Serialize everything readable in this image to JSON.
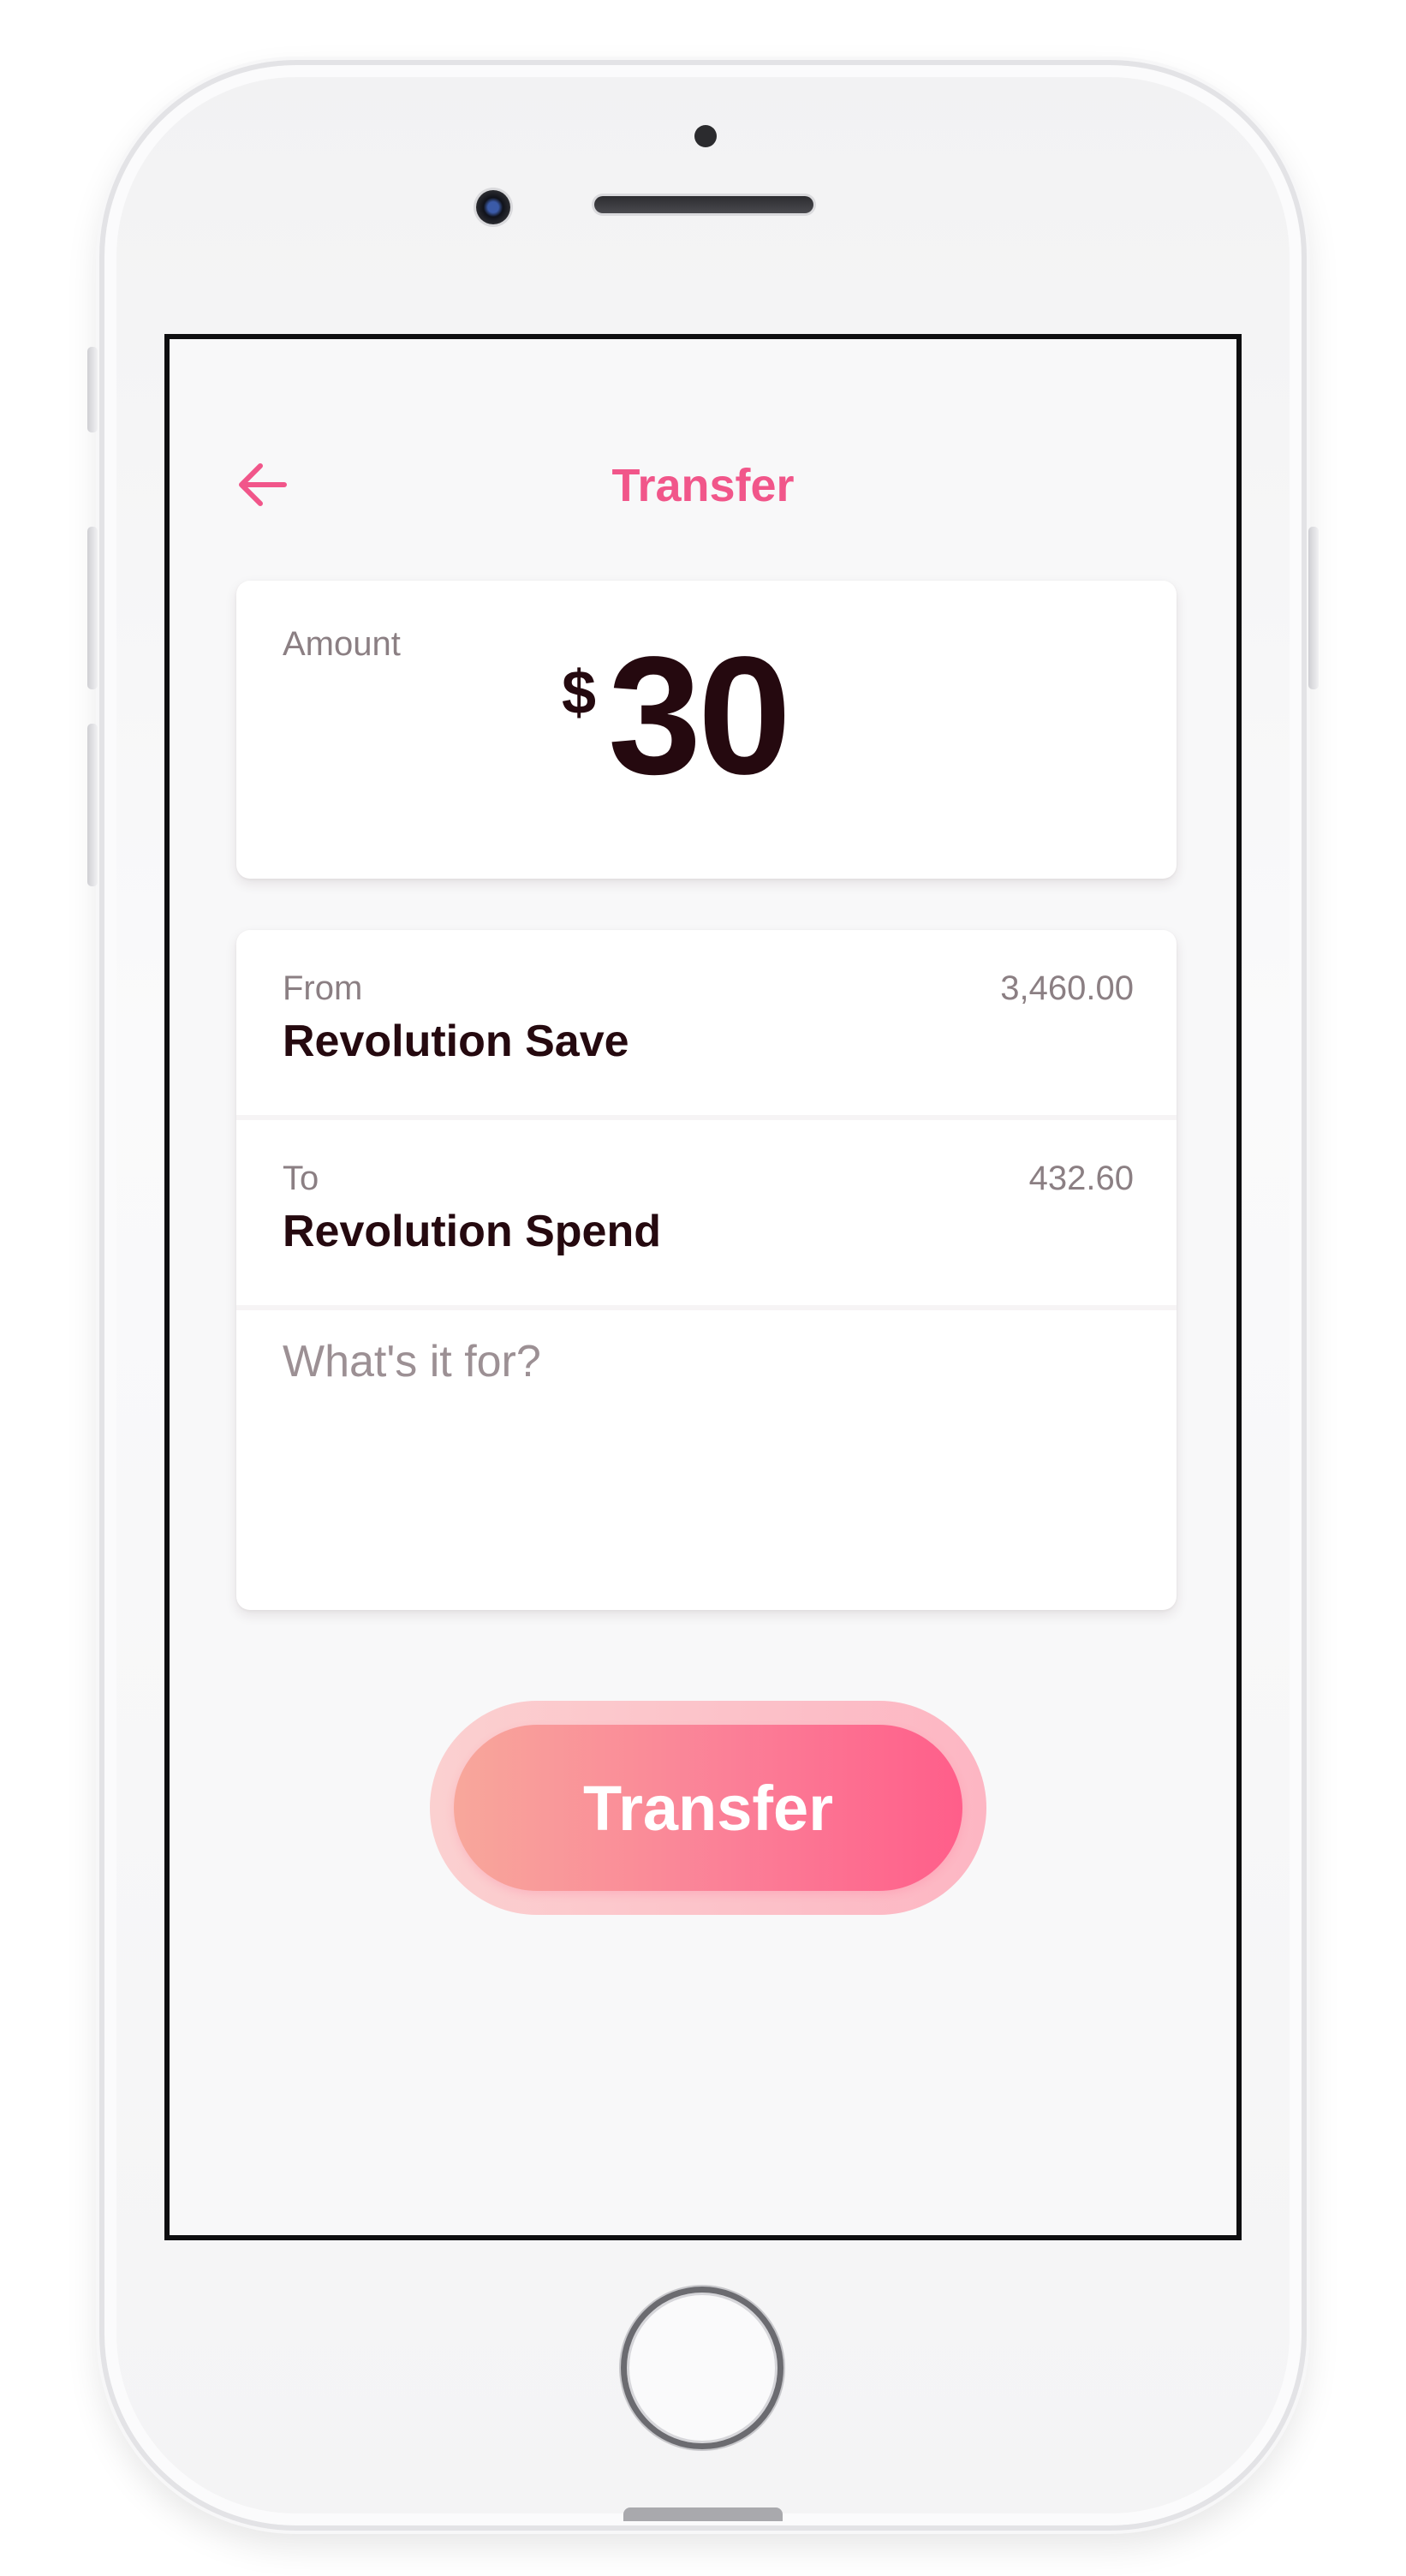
{
  "header": {
    "title": "Transfer",
    "back_icon": "arrow-left-icon"
  },
  "amount": {
    "label": "Amount",
    "currency_symbol": "$",
    "value": "30"
  },
  "from_account": {
    "label": "From",
    "name": "Revolution Save",
    "balance": "3,460.00"
  },
  "to_account": {
    "label": "To",
    "name": "Revolution Spend",
    "balance": "432.60"
  },
  "memo": {
    "placeholder": "What's it for?",
    "value": ""
  },
  "actions": {
    "transfer_label": "Transfer"
  },
  "colors": {
    "accent": "#f1568a",
    "text_dark": "#25090f",
    "text_muted": "#8b7f83",
    "button_gradient_start": "#f8a79b",
    "button_gradient_end": "#ff5e8a",
    "screen_background": "#f8f8f9"
  }
}
